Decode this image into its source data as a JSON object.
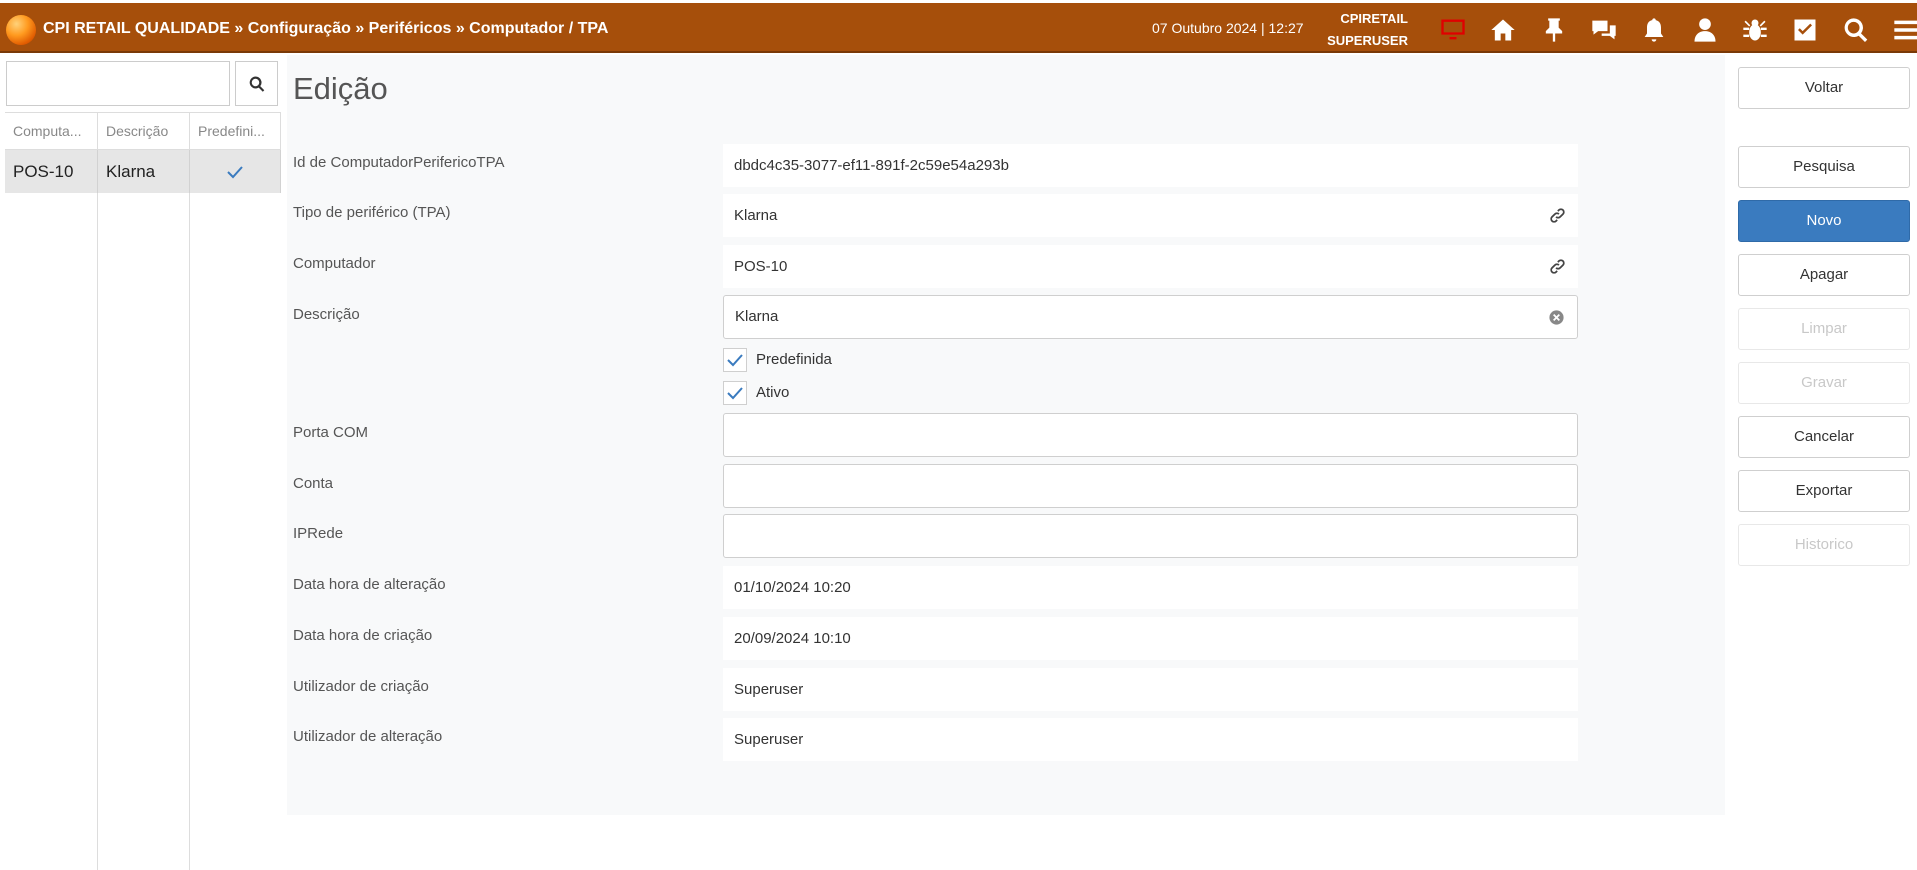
{
  "header": {
    "breadcrumb": "CPI RETAIL QUALIDADE » Configuração » Periféricos » Computador / TPA",
    "datetime": "07 Outubro 2024 | 12:27",
    "company": "CPIRETAIL",
    "user": "SUPERUSER",
    "icons": [
      "monitor-icon",
      "home-icon",
      "pin-icon",
      "chat-icon",
      "bell-icon",
      "user-icon",
      "bug-icon",
      "checkbox-icon",
      "search-icon",
      "menu-icon"
    ],
    "accent_color": "#a64f0b",
    "monitor_icon_color": "#e00000"
  },
  "sidebar": {
    "search_value": "",
    "columns": [
      "Computa...",
      "Descrição",
      "Predefini..."
    ],
    "rows": [
      {
        "computer": "POS-10",
        "description": "Klarna",
        "default": true
      }
    ]
  },
  "form": {
    "title": "Edição",
    "fields": {
      "id": {
        "label": "Id de ComputadorPerifericoTPA",
        "value": "dbdc4c35-3077-ef11-891f-2c59e54a293b"
      },
      "tipo": {
        "label": "Tipo de periférico (TPA)",
        "value": "Klarna"
      },
      "computador": {
        "label": "Computador",
        "value": "POS-10"
      },
      "descricao": {
        "label": "Descrição",
        "value": "Klarna"
      },
      "predefinida": {
        "label": "Predefinida",
        "checked": true
      },
      "ativo": {
        "label": "Ativo",
        "checked": true
      },
      "porta_com": {
        "label": "Porta COM",
        "value": ""
      },
      "conta": {
        "label": "Conta",
        "value": ""
      },
      "iprede": {
        "label": "IPRede",
        "value": ""
      },
      "data_alteracao": {
        "label": "Data hora de alteração",
        "value": "01/10/2024 10:20"
      },
      "data_criacao": {
        "label": "Data hora de criação",
        "value": "20/09/2024 10:10"
      },
      "utilizador_criacao": {
        "label": "Utilizador de criação",
        "value": "Superuser"
      },
      "utilizador_alteracao": {
        "label": "Utilizador de alteração",
        "value": "Superuser"
      }
    }
  },
  "actions": {
    "voltar": "Voltar",
    "pesquisa": "Pesquisa",
    "novo": "Novo",
    "apagar": "Apagar",
    "limpar": "Limpar",
    "gravar": "Gravar",
    "cancelar": "Cancelar",
    "exportar": "Exportar",
    "historico": "Historico",
    "primary_color": "#3a7bbf"
  }
}
